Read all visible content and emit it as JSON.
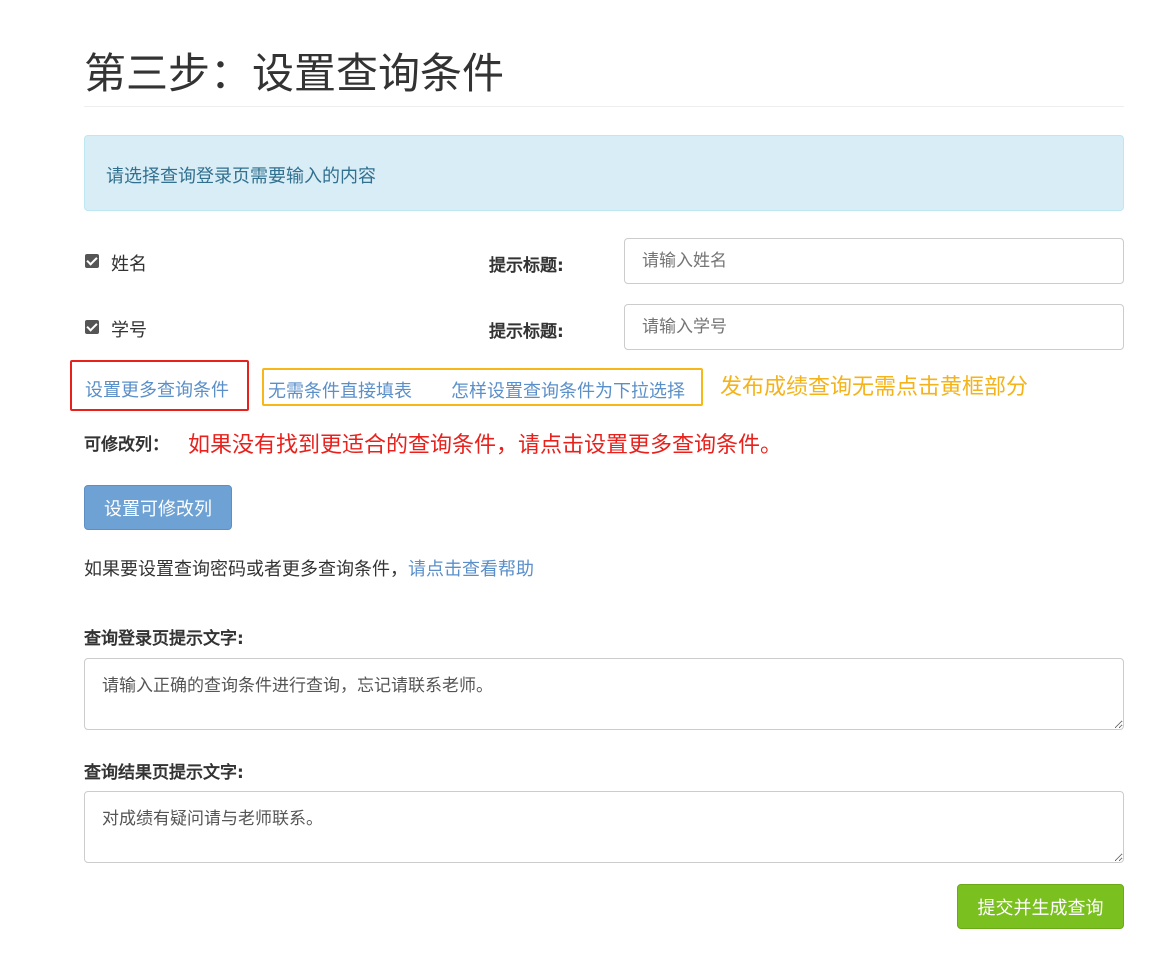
{
  "page": {
    "title": "第三步：设置查询条件"
  },
  "alert": {
    "text": "请选择查询登录页需要输入的内容"
  },
  "fields": [
    {
      "name": "姓名",
      "checked": true,
      "hint_label": "提示标题:",
      "placeholder": "请输入姓名"
    },
    {
      "name": "学号",
      "checked": true,
      "hint_label": "提示标题:",
      "placeholder": "请输入学号"
    }
  ],
  "links": {
    "more_conditions": "设置更多查询条件",
    "no_conditions": "无需条件直接填表",
    "dropdown_howto": "怎样设置查询条件为下拉选择"
  },
  "annotations": {
    "yellow_note": "发布成绩查询无需点击黄框部分",
    "red_note": "如果没有找到更适合的查询条件，请点击设置更多查询条件。"
  },
  "editable": {
    "label": "可修改列：",
    "button": "设置可修改列"
  },
  "help": {
    "prefix": "如果要设置查询密码或者更多查询条件，",
    "link": "请点击查看帮助"
  },
  "login_hint": {
    "label": "查询登录页提示文字:",
    "value": "请输入正确的查询条件进行查询，忘记请联系老师。"
  },
  "result_hint": {
    "label": "查询结果页提示文字:",
    "value": "对成绩有疑问请与老师联系。"
  },
  "submit": {
    "label": "提交并生成查询"
  },
  "colors": {
    "link": "#5b8fc9",
    "alert_bg": "#d9edf7",
    "alert_text": "#31708f",
    "red_annotation": "#e8211c",
    "yellow_annotation": "#f4b31a",
    "primary_button": "#6ea1d4",
    "success_button": "#7ac01f"
  }
}
